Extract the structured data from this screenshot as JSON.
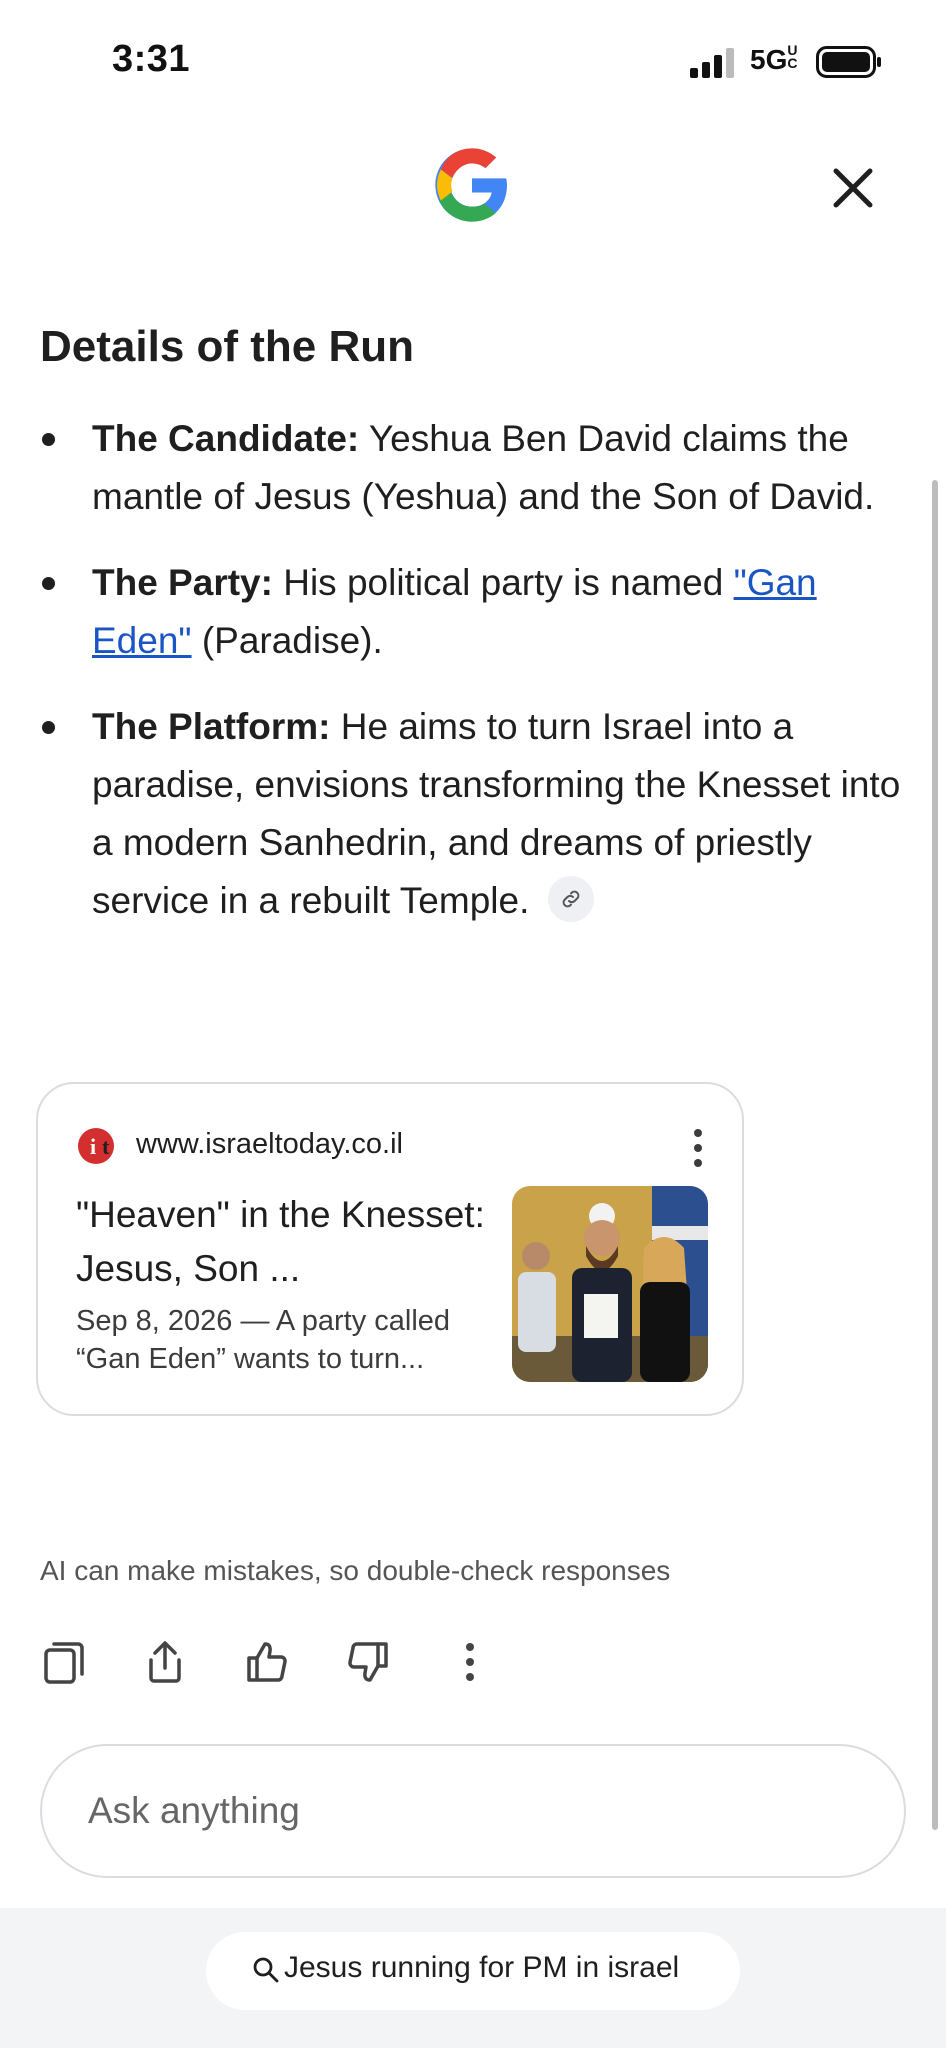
{
  "status_bar": {
    "time": "3:31",
    "network": "5G",
    "network_sup": "UC"
  },
  "header": {
    "logo_icon": "google-g-icon",
    "close_icon": "close-icon"
  },
  "content": {
    "heading": "Details of the Run",
    "bullets": [
      {
        "label": "The Candidate:",
        "text": " Yeshua Ben David claims the mantle of Jesus (Yeshua) and the Son of David."
      },
      {
        "label": "The Party:",
        "text_before": " His political party is named ",
        "link": "\"Gan Eden\"",
        "text_after": " (Paradise)."
      },
      {
        "label": "The Platform:",
        "text": " He aims to turn Israel into a paradise, envisions transforming the Knesset into a modern Sanhedrin, and dreams of priestly service in a rebuilt Temple.",
        "citation_icon": "link-icon"
      }
    ]
  },
  "source_card": {
    "favicon_text": "it",
    "domain": "www.israeltoday.co.il",
    "title": "\"Heaven\" in the Knesset: Jesus, Son ...",
    "snippet": "Sep 8, 2026 — A party called “Gan Eden” wants to turn...",
    "more_icon": "more-vert-icon",
    "thumbnail_icon": "news-photo-thumbnail"
  },
  "disclaimer": "AI can make mistakes, so double-check responses",
  "actions": [
    "copy-icon",
    "share-icon",
    "thumbs-up-icon",
    "thumbs-down-icon",
    "more-vert-icon"
  ],
  "input": {
    "placeholder": "Ask anything"
  },
  "query_chip": {
    "icon": "search-icon",
    "text": "Jesus running for PM in israel"
  },
  "colors": {
    "link": "#1a55c6",
    "favicon_red": "#d32f2f",
    "card_border": "#dadce0"
  }
}
